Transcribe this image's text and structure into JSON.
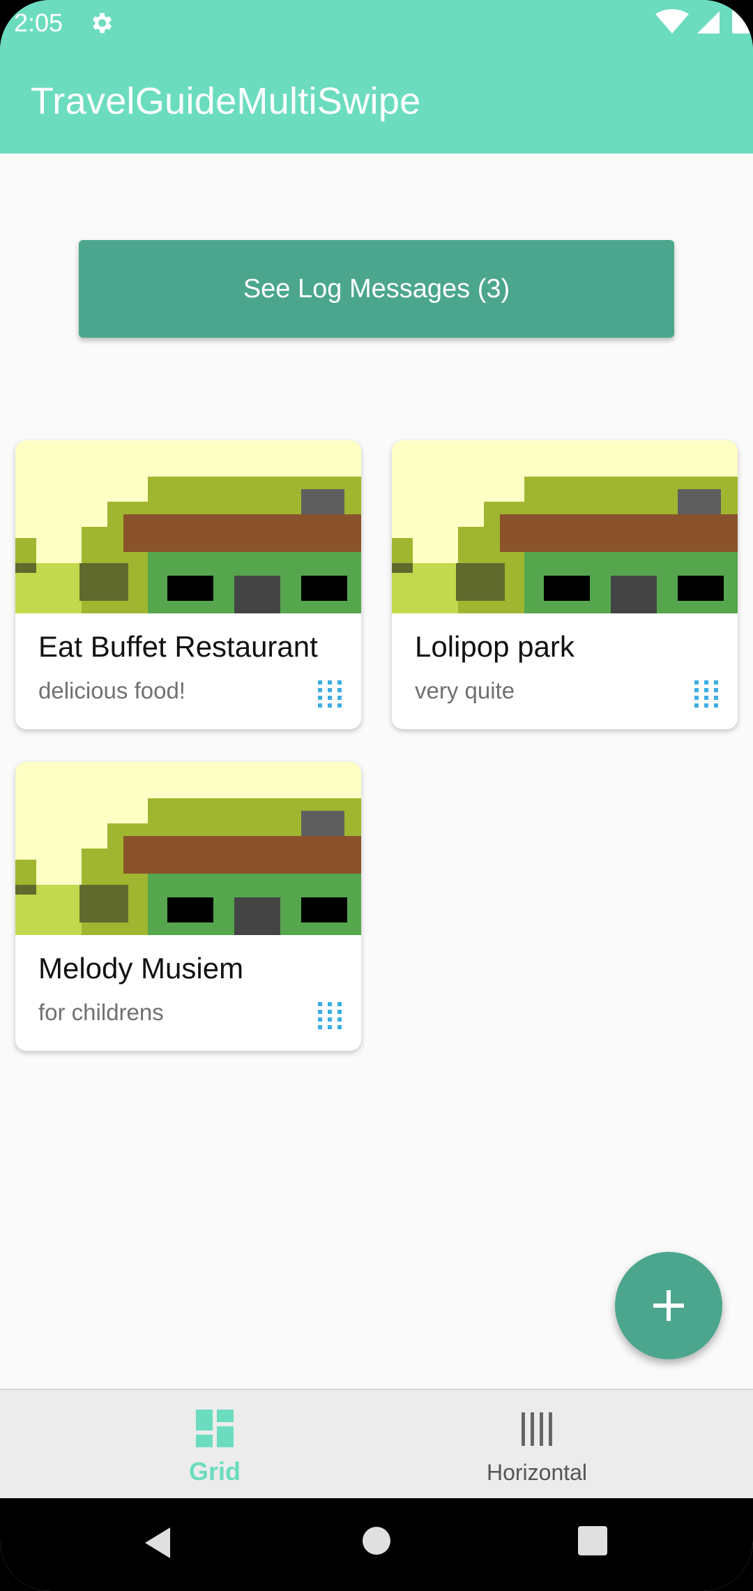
{
  "status_bar": {
    "time": "2:05",
    "icons": [
      "settings-icon",
      "wifi-icon",
      "cell-signal-icon",
      "battery-icon"
    ]
  },
  "app_bar": {
    "title": "TravelGuideMultiSwipe",
    "color": "#6cdcbf"
  },
  "log_button": {
    "label": "See Log Messages (3)",
    "color": "#4ba68d"
  },
  "places": [
    {
      "name": "Eat Buffet Restaurant",
      "description": "delicious food!",
      "image": "building-thumbnail",
      "handle_icon": "drag-handle-icon"
    },
    {
      "name": "Lolipop park",
      "description": "very quite",
      "image": "building-thumbnail",
      "handle_icon": "drag-handle-icon"
    },
    {
      "name": "Melody Musiem",
      "description": "for childrens",
      "image": "building-thumbnail",
      "handle_icon": "drag-handle-icon"
    }
  ],
  "fab": {
    "icon": "plus-icon",
    "color": "#4ba68d"
  },
  "bottom_nav": {
    "items": [
      {
        "label": "Grid",
        "icon": "grid-dashboard-icon",
        "selected": true
      },
      {
        "label": "Horizontal",
        "icon": "vertical-bars-icon",
        "selected": false
      }
    ],
    "active_color": "#6cdcbf"
  },
  "system_nav": [
    "back-icon",
    "home-icon",
    "recents-icon"
  ]
}
